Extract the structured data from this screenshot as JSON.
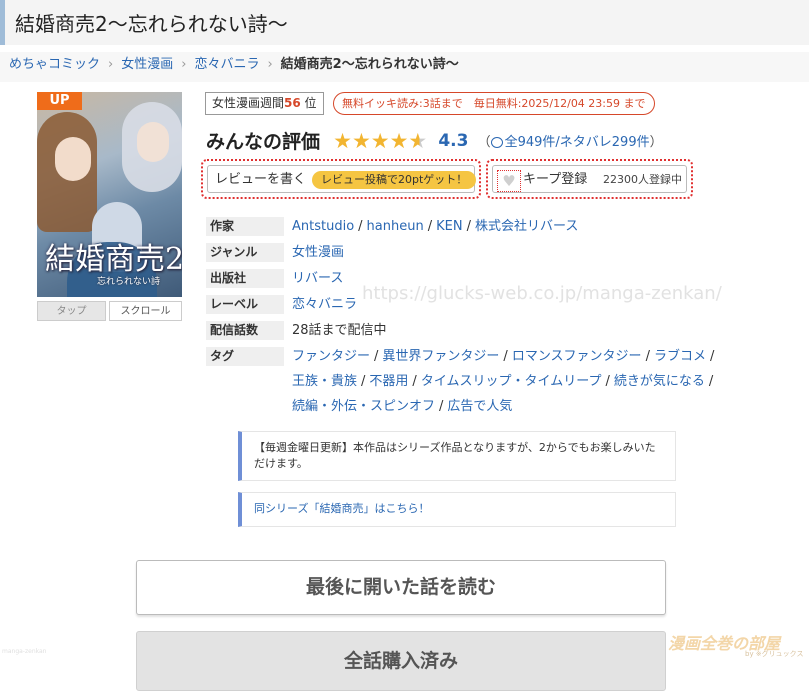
{
  "page": {
    "title": "結婚商売2〜忘れられない詩〜"
  },
  "breadcrumb": {
    "items": [
      "めちゃコミック",
      "女性漫画",
      "恋々バニラ"
    ],
    "current": "結婚商売2〜忘れられない詩〜"
  },
  "cover": {
    "badge": "UP",
    "logo_text": "結婚商売2",
    "logo_sub": "忘れられない詩",
    "controls": {
      "tap": "タップ",
      "scroll": "スクロール"
    }
  },
  "ranking": {
    "prefix": "女性漫画週間",
    "rank": "56",
    "suffix": "位"
  },
  "free_campaign": "無料イッキ読み:3話まで　毎日無料:2025/12/04 23:59 まで",
  "rating": {
    "label": "みんなの評価",
    "score": "4.3",
    "stars_value": 4.3,
    "stars_max": 5,
    "reviews_prefix": "（",
    "reviews_link": "全949件/ネタバレ299件",
    "reviews_suffix": "）"
  },
  "review_button": {
    "label": "レビューを書く",
    "pill": "レビュー投稿で20ptゲット！"
  },
  "keep_button": {
    "label": "キープ登録",
    "count": "22300人登録中"
  },
  "info": {
    "author_key": "作家",
    "authors": [
      "Antstudio",
      "hanheun",
      "KEN",
      "株式会社リバース"
    ],
    "genre_key": "ジャンル",
    "genre": "女性漫画",
    "publisher_key": "出版社",
    "publisher": "リバース",
    "label_key": "レーベル",
    "label": "恋々バニラ",
    "episodes_key": "配信話数",
    "episodes": "28話まで配信中",
    "tags_key": "タグ",
    "tags": [
      "ファンタジー",
      "異世界ファンタジー",
      "ロマンスファンタジー",
      "ラブコメ",
      "王族・貴族",
      "不器用",
      "タイムスリップ・タイムリープ",
      "続きが気になる",
      "続編・外伝・スピンオフ",
      "広告で人気"
    ]
  },
  "watermark": "https://glucks-web.co.jp/manga-zenkan/",
  "notices": {
    "weekly": "【毎週金曜日更新】本作品はシリーズ作品となりますが、2からでもお楽しみいただけます。",
    "series_link": "同シリーズ「結婚商売」はこちら！"
  },
  "buttons": {
    "read_last": "最後に開いた話を読む",
    "all_bought": "全話購入済み"
  },
  "overlay_marks": {
    "corner": "漫画全巻の部屋",
    "corner_sub": "by ※グリュックス",
    "left": "manga-zenkan"
  },
  "colors": {
    "link": "#2a67b2",
    "accent_red": "#d6482a",
    "star": "#f2b531",
    "up_badge": "#ef6c1a",
    "pill": "#f5c542"
  }
}
